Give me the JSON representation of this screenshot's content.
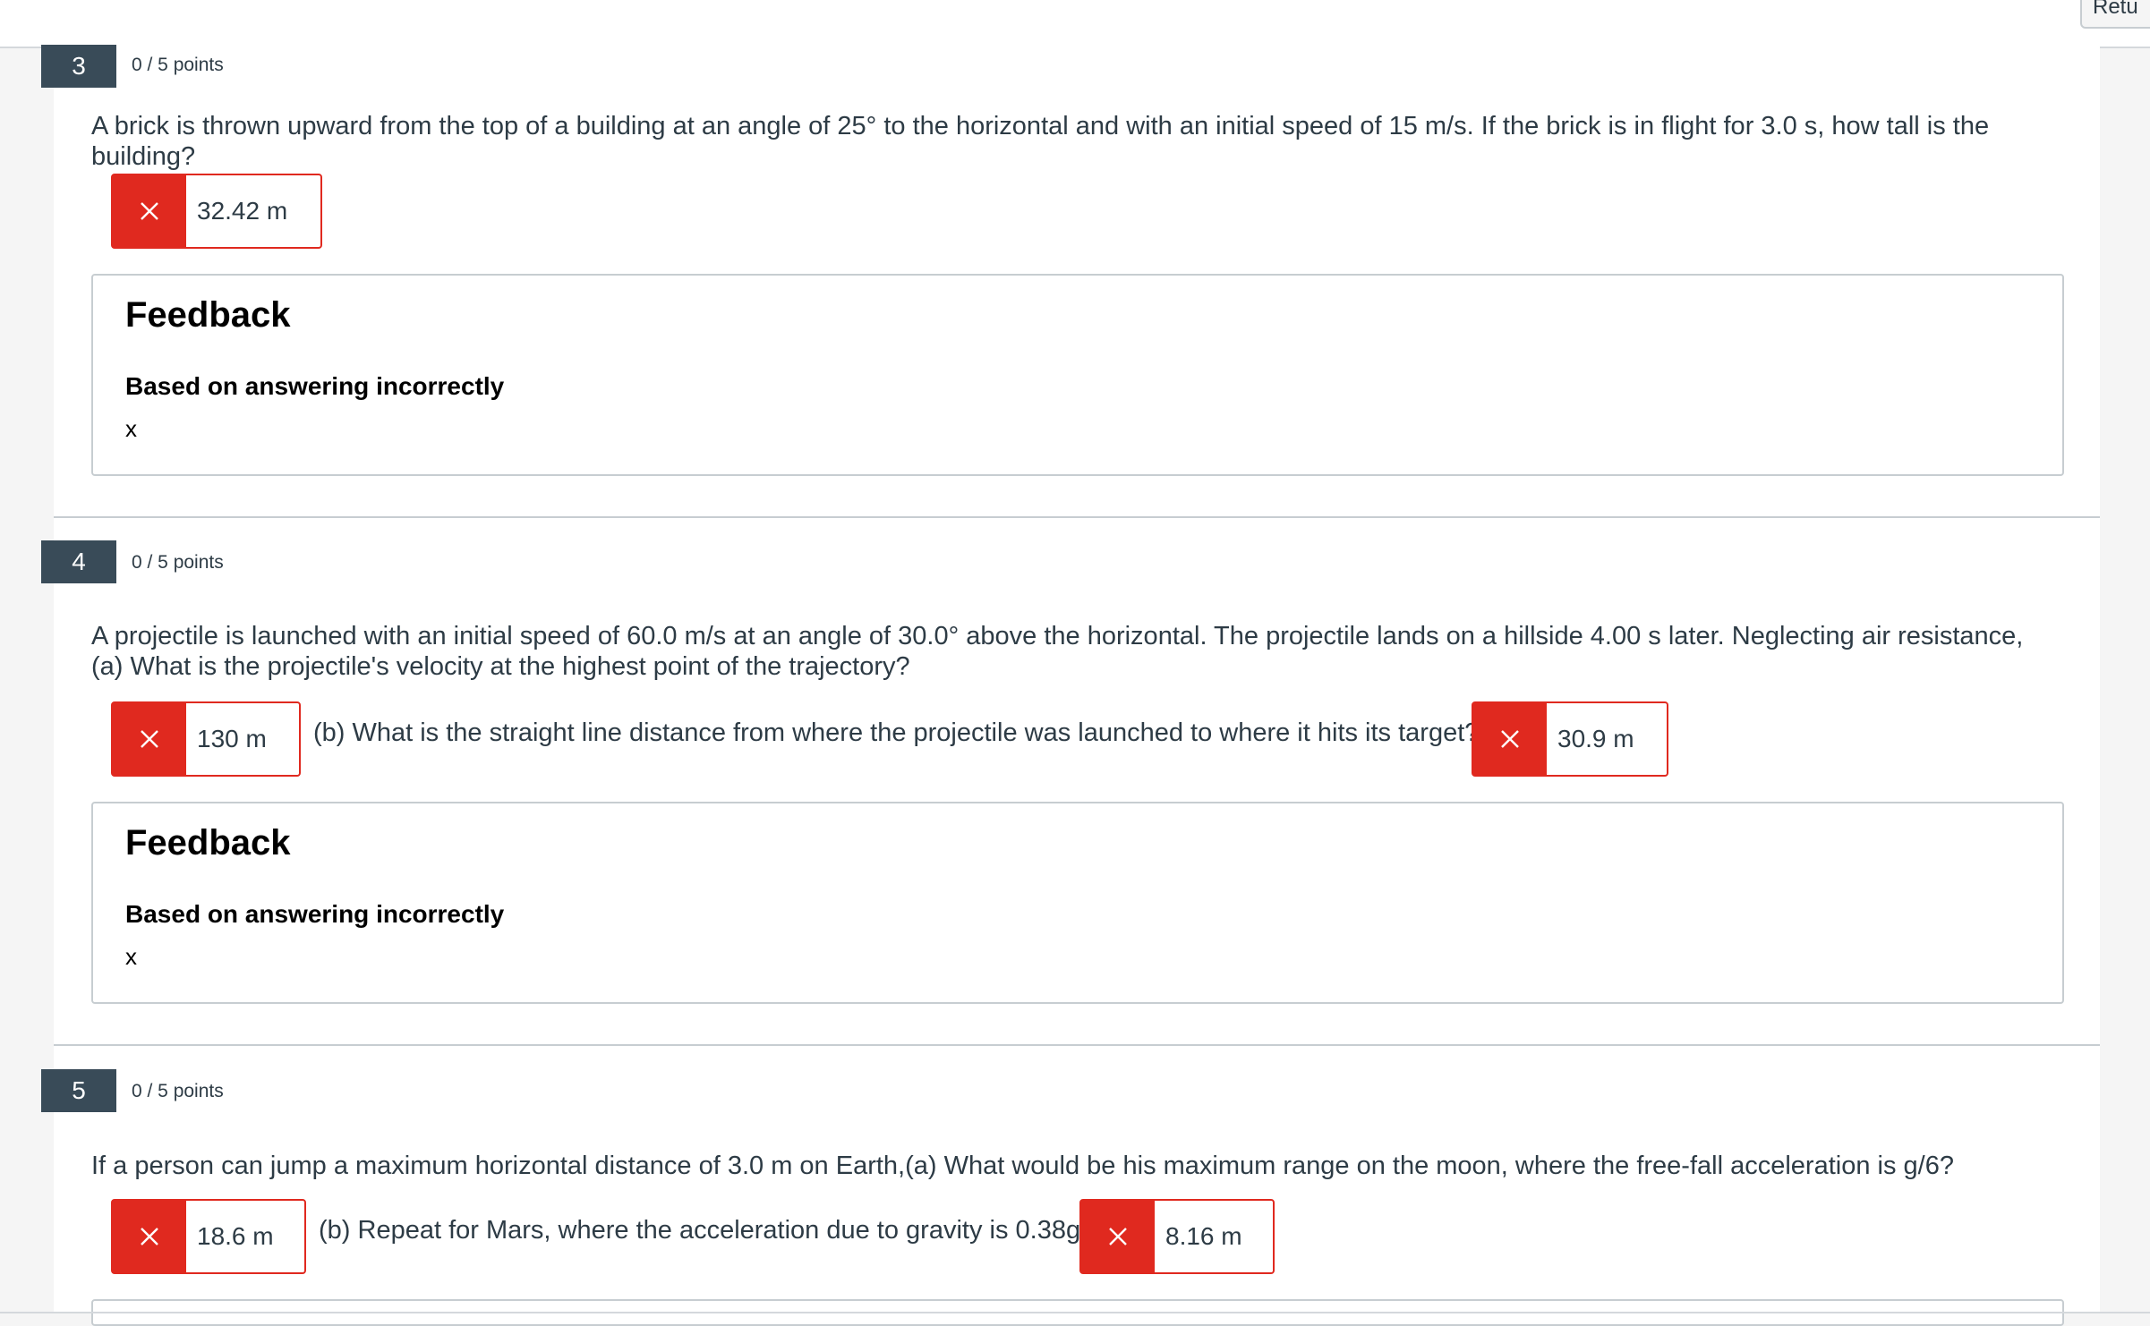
{
  "top_button_partial_label": "Retu",
  "close_glyph": "✕",
  "questions": [
    {
      "number": "3",
      "points": "0 / 5 points",
      "text": "A brick is thrown upward from the top of a building at an angle of 25° to the horizontal and with an initial speed of 15 m/s. If the brick is in flight for 3.0 s, how tall is the building?",
      "answer": "32.42 m",
      "feedback": {
        "title": "Feedback",
        "subtitle": "Based on answering incorrectly",
        "body": "x"
      }
    },
    {
      "number": "4",
      "points": "0 / 5 points",
      "text": "A projectile is launched with an initial speed of 60.0 m/s at an angle of 30.0° above the horizontal. The projectile lands on a hillside 4.00 s later. Neglecting air resistance, (a) What is the projectile's velocity at the highest point of the trajectory?",
      "answer_a": "130 m",
      "part_b_text": "(b) What is the straight line distance from where the projectile was launched to where it hits its target?",
      "answer_b": "30.9 m",
      "feedback": {
        "title": "Feedback",
        "subtitle": "Based on answering incorrectly",
        "body": "x"
      }
    },
    {
      "number": "5",
      "points": "0 / 5 points",
      "text": "If a person can jump a maximum horizontal distance of 3.0 m on Earth,(a) What would be his maximum range on the moon, where the free-fall acceleration is g/6?",
      "answer_a": "18.6 m",
      "part_b_text": "(b) Repeat for Mars, where the acceleration due to gravity is 0.38g.",
      "answer_b": "8.16 m"
    }
  ],
  "colors": {
    "incorrect": "#e0291f",
    "number_badge": "#394b58",
    "border": "#c7cdd1"
  }
}
